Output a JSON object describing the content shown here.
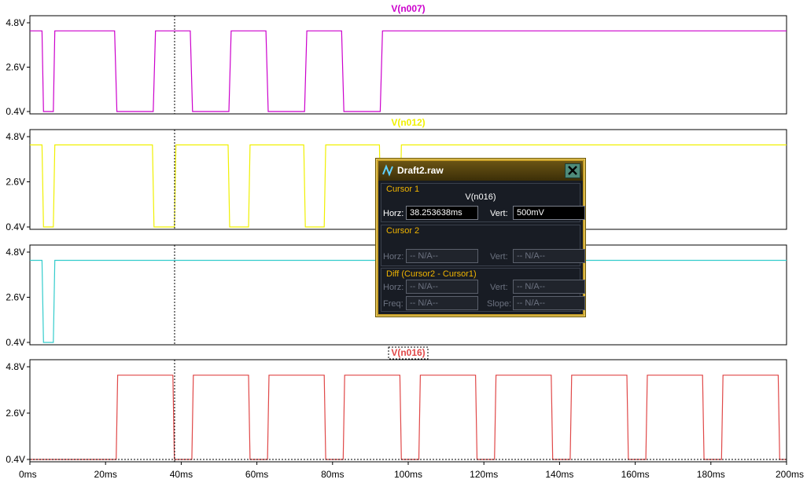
{
  "window": {
    "cursor_dialog": {
      "title": "Draft2.raw",
      "close_icon": "close-x-icon",
      "app_icon": "ltspice-waveform-icon",
      "cursor1": {
        "group_label": "Cursor 1",
        "trace": "V(n016)",
        "horz_label": "Horz:",
        "horz_value": "38.253638ms",
        "vert_label": "Vert:",
        "vert_value": "500mV"
      },
      "cursor2": {
        "group_label": "Cursor 2",
        "horz_label": "Horz:",
        "horz_value": "-- N/A--",
        "vert_label": "Vert:",
        "vert_value": "-- N/A--"
      },
      "diff": {
        "group_label": "Diff (Cursor2 - Cursor1)",
        "horz_label": "Horz:",
        "horz_value": "-- N/A--",
        "vert_label": "Vert:",
        "vert_value": "-- N/A--",
        "freq_label": "Freq:",
        "freq_value": "-- N/A--",
        "slope_label": "Slope:",
        "slope_value": "-- N/A--"
      }
    }
  },
  "chart_data": {
    "type": "line",
    "x_unit": "ms",
    "xlim": [
      0,
      200
    ],
    "x_ticks": [
      "0ms",
      "20ms",
      "40ms",
      "60ms",
      "80ms",
      "100ms",
      "120ms",
      "140ms",
      "160ms",
      "180ms",
      "200ms"
    ],
    "cursor1_x": 38.25,
    "grid": false,
    "panes": [
      {
        "title": "V(n007)",
        "color": "#cc00cc",
        "ylim": [
          0.4,
          4.8
        ],
        "y_ticks": [
          "4.8V",
          "2.6V",
          "0.4V"
        ],
        "points": [
          [
            0,
            4.4
          ],
          [
            3.2,
            4.4
          ],
          [
            3.6,
            0.4
          ],
          [
            6.2,
            0.4
          ],
          [
            6.6,
            4.4
          ],
          [
            22.4,
            4.4
          ],
          [
            23,
            0.4
          ],
          [
            32.6,
            0.4
          ],
          [
            33.2,
            4.4
          ],
          [
            42.4,
            4.4
          ],
          [
            43,
            0.4
          ],
          [
            52.6,
            0.4
          ],
          [
            53.2,
            4.4
          ],
          [
            62.4,
            4.4
          ],
          [
            63,
            0.4
          ],
          [
            72.6,
            0.4
          ],
          [
            73.2,
            4.4
          ],
          [
            82.4,
            4.4
          ],
          [
            83,
            0.4
          ],
          [
            92.6,
            0.4
          ],
          [
            93.2,
            4.4
          ],
          [
            200,
            4.4
          ]
        ]
      },
      {
        "title": "V(n012)",
        "color": "#f0f000",
        "ylim": [
          0.4,
          4.8
        ],
        "y_ticks": [
          "4.8V",
          "2.6V",
          "0.4V"
        ],
        "points": [
          [
            0,
            4.4
          ],
          [
            3.2,
            4.4
          ],
          [
            3.6,
            0.4
          ],
          [
            6.2,
            0.4
          ],
          [
            6.6,
            4.4
          ],
          [
            32.4,
            4.4
          ],
          [
            32.8,
            0.4
          ],
          [
            38.2,
            0.4
          ],
          [
            38.6,
            4.4
          ],
          [
            52.4,
            4.4
          ],
          [
            52.8,
            0.4
          ],
          [
            57.8,
            0.4
          ],
          [
            58.2,
            4.4
          ],
          [
            72.4,
            4.4
          ],
          [
            72.8,
            0.4
          ],
          [
            77.8,
            0.4
          ],
          [
            78.2,
            4.4
          ],
          [
            92.4,
            4.4
          ],
          [
            92.8,
            0.4
          ],
          [
            97.8,
            0.4
          ],
          [
            98.2,
            4.4
          ],
          [
            200,
            4.4
          ]
        ]
      },
      {
        "title": "",
        "color": "#33cccc",
        "ylim": [
          0.4,
          4.8
        ],
        "y_ticks": [
          "4.8V",
          "2.6V",
          "0.4V"
        ],
        "points": [
          [
            0,
            4.4
          ],
          [
            3.2,
            4.4
          ],
          [
            3.6,
            0.4
          ],
          [
            6.2,
            0.4
          ],
          [
            6.6,
            4.4
          ],
          [
            200,
            4.4
          ]
        ]
      },
      {
        "title": "V(n016)",
        "color": "#e04848",
        "ylim": [
          0.4,
          4.8
        ],
        "y_ticks": [
          "4.8V",
          "2.6V",
          "0.4V"
        ],
        "points": [
          [
            0,
            0.4
          ],
          [
            22.8,
            0.4
          ],
          [
            23.2,
            4.4
          ],
          [
            37.8,
            4.4
          ],
          [
            38.2,
            0.4
          ],
          [
            42.8,
            0.4
          ],
          [
            43.2,
            4.4
          ],
          [
            57.8,
            4.4
          ],
          [
            58.2,
            0.4
          ],
          [
            62.8,
            0.4
          ],
          [
            63.2,
            4.4
          ],
          [
            77.8,
            4.4
          ],
          [
            78.2,
            0.4
          ],
          [
            82.8,
            0.4
          ],
          [
            83.2,
            4.4
          ],
          [
            97.8,
            4.4
          ],
          [
            98.2,
            0.4
          ],
          [
            102.8,
            0.4
          ],
          [
            103.2,
            4.4
          ],
          [
            117.8,
            4.4
          ],
          [
            118.2,
            0.4
          ],
          [
            122.8,
            0.4
          ],
          [
            123.2,
            4.4
          ],
          [
            137.8,
            4.4
          ],
          [
            138.2,
            0.4
          ],
          [
            142.8,
            0.4
          ],
          [
            143.2,
            4.4
          ],
          [
            157.8,
            4.4
          ],
          [
            158.2,
            0.4
          ],
          [
            162.8,
            0.4
          ],
          [
            163.2,
            4.4
          ],
          [
            177.8,
            4.4
          ],
          [
            178.2,
            0.4
          ],
          [
            182.8,
            0.4
          ],
          [
            183.2,
            4.4
          ],
          [
            197.8,
            4.4
          ],
          [
            198.2,
            0.4
          ],
          [
            200,
            0.4
          ]
        ]
      }
    ]
  }
}
